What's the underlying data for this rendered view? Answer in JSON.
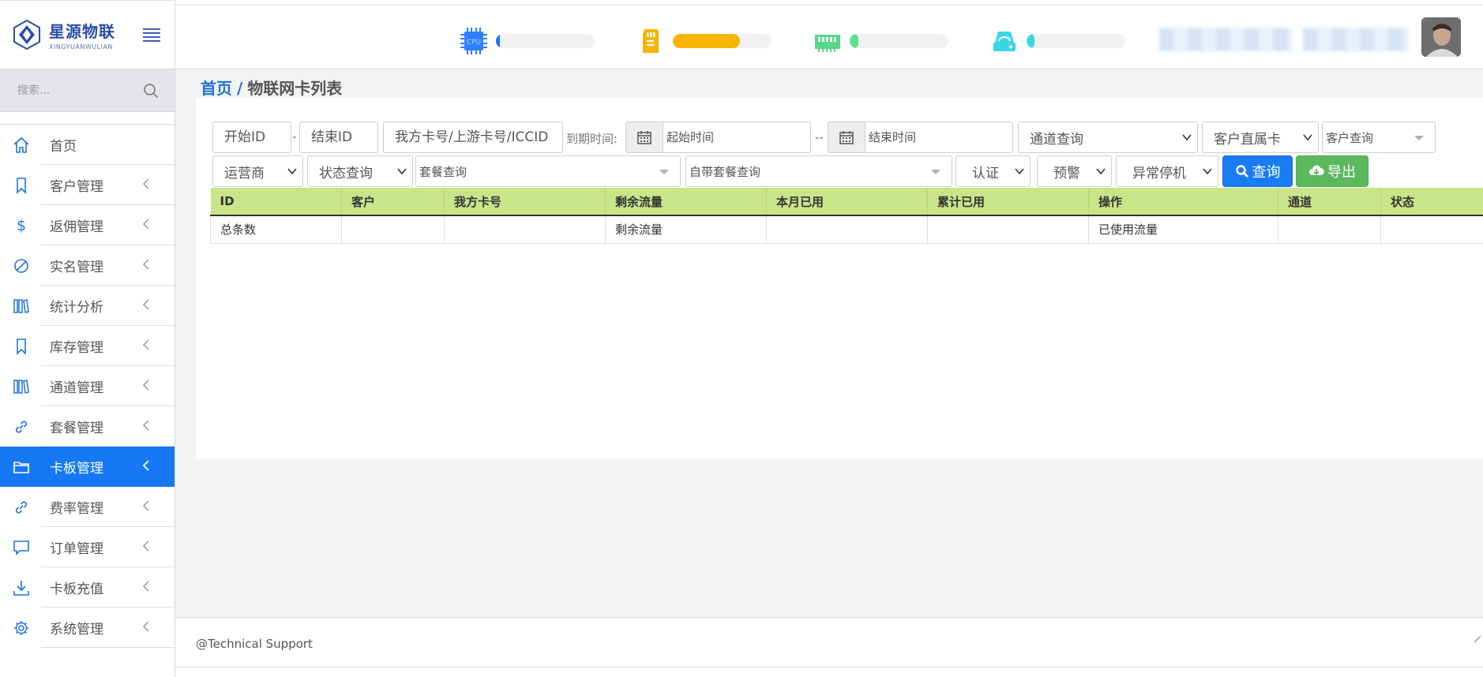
{
  "logo": {
    "name_cn": "星源物联",
    "name_en": "XINGYUANWULIAN"
  },
  "search": {
    "placeholder": "搜索..."
  },
  "sidebar": {
    "items": [
      {
        "label": "首页",
        "icon": "home-icon"
      },
      {
        "label": "客户管理",
        "icon": "bookmark-icon"
      },
      {
        "label": "返佣管理",
        "icon": "dollar-icon"
      },
      {
        "label": "实名管理",
        "icon": "ban-icon"
      },
      {
        "label": "统计分析",
        "icon": "books-icon"
      },
      {
        "label": "库存管理",
        "icon": "bookmark-icon"
      },
      {
        "label": "通道管理",
        "icon": "books-icon"
      },
      {
        "label": "套餐管理",
        "icon": "link-icon"
      },
      {
        "label": "卡板管理",
        "icon": "folder-icon"
      },
      {
        "label": "费率管理",
        "icon": "link-icon"
      },
      {
        "label": "订单管理",
        "icon": "comment-icon"
      },
      {
        "label": "卡板充值",
        "icon": "download-icon"
      },
      {
        "label": "系统管理",
        "icon": "gear-icon"
      }
    ],
    "active_index": 8
  },
  "header": {
    "monitors": [
      {
        "icon": "cpu-icon",
        "icon_text": "CPU",
        "level": 0.04,
        "color": "#1f74ff"
      },
      {
        "icon": "sd-card-icon",
        "level": 0.68,
        "color": "#f7b500"
      },
      {
        "icon": "memory-icon",
        "level": 0.09,
        "color": "#5fe08a"
      },
      {
        "icon": "disk-icon",
        "level": 0.08,
        "color": "#3ad6e6"
      }
    ]
  },
  "breadcrumb": {
    "home": "首页",
    "separator": "/",
    "current": "物联网卡列表"
  },
  "filters": {
    "start_id": "开始ID",
    "dash": "-",
    "end_id": "结束ID",
    "card_no": "我方卡号/上游卡号/ICCID",
    "expire_label": "到期时间:",
    "start_time": "起始时间",
    "range_sep": "--",
    "end_time": "结束时间",
    "channel": "通道查询",
    "customer_direct": "客户直属卡",
    "customer_query": "客户查询",
    "operator": "运营商",
    "status": "状态查询",
    "package": "套餐查询",
    "own_package": "自带套餐查询",
    "auth": "认证",
    "warning": "预警",
    "abnormal_stop": "异常停机",
    "query_btn": "查询",
    "export_btn": "导出"
  },
  "table": {
    "columns": [
      "ID",
      "客户",
      "我方卡号",
      "剩余流量",
      "本月已用",
      "累计已用",
      "操作",
      "通道",
      "状态"
    ],
    "rows": [
      [
        "总条数",
        "",
        "",
        "剩余流量",
        "",
        "",
        "已使用流量",
        "",
        ""
      ]
    ]
  },
  "footer": {
    "text": "@Technical Support"
  },
  "colors": {
    "accent": "#1678f2",
    "table_header": "#c9e58a",
    "export": "#5cb85c"
  }
}
